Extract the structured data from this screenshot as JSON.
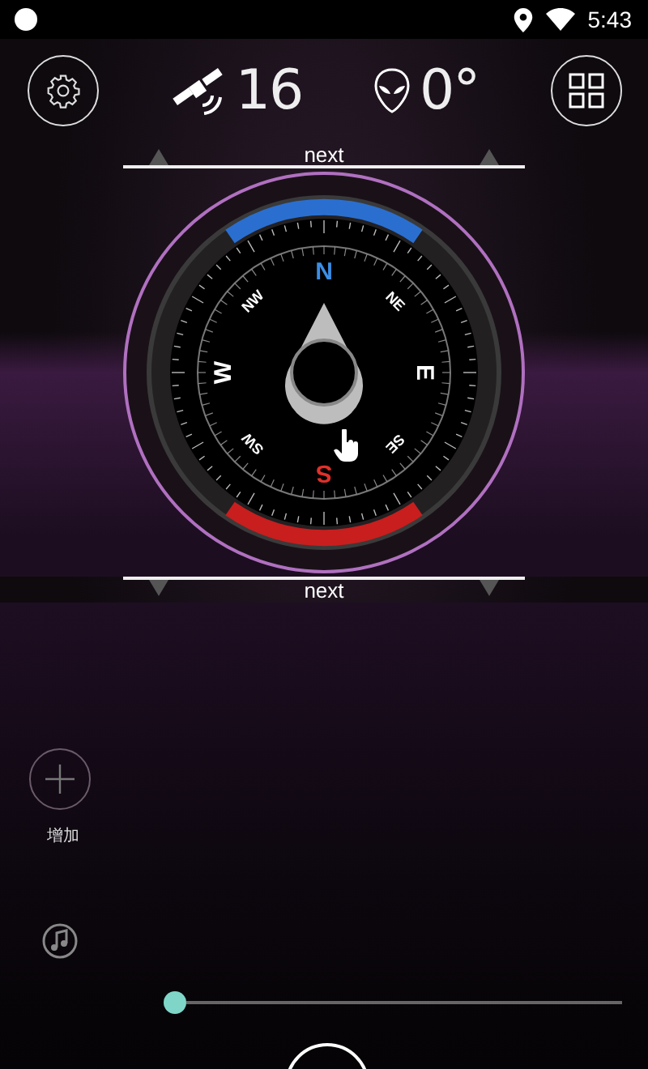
{
  "status_bar": {
    "time": "5:43"
  },
  "header": {
    "satellites": "16",
    "heading": "0°"
  },
  "top_next": {
    "label": "next"
  },
  "compass": {
    "points": [
      {
        "label": "N",
        "color": "#3a8ee6"
      },
      {
        "label": "NE",
        "color": "#ffffff"
      },
      {
        "label": "E",
        "color": "#ffffff"
      },
      {
        "label": "SE",
        "color": "#ffffff"
      },
      {
        "label": "S",
        "color": "#e0302a"
      },
      {
        "label": "SW",
        "color": "#ffffff"
      },
      {
        "label": "W",
        "color": "#ffffff"
      },
      {
        "label": "NW",
        "color": "#ffffff"
      }
    ]
  },
  "bottom_next": {
    "label": "next"
  },
  "add_button": {
    "label": "增加"
  },
  "slider": {
    "level": 0
  }
}
